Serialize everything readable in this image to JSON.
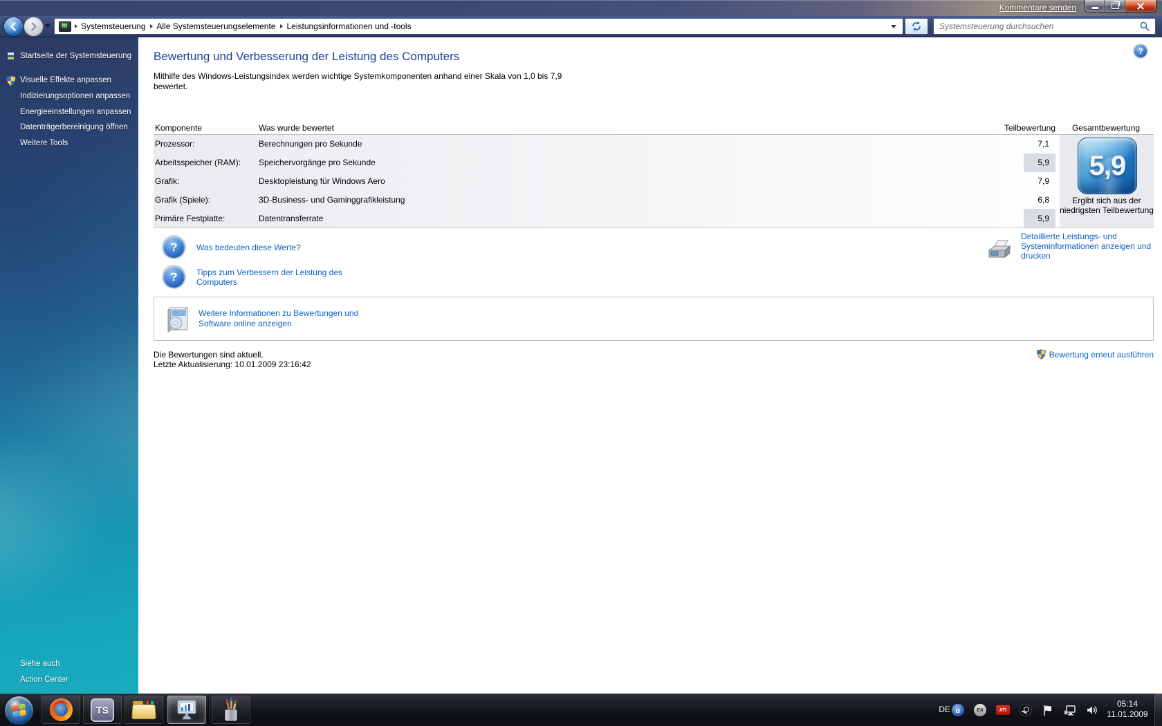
{
  "window": {
    "feedback_link": "Kommentare senden",
    "breadcrumbs": [
      "Systemsteuerung",
      "Alle Systemsteuerungselemente",
      "Leistungsinformationen und -tools"
    ],
    "search_placeholder": "Systemsteuerung durchsuchen"
  },
  "sidebar": {
    "items": [
      {
        "label": "Startseite der Systemsteuerung"
      },
      {
        "label": "Visuelle Effekte anpassen"
      },
      {
        "label": "Indizierungsoptionen anpassen"
      },
      {
        "label": "Energieeinstellungen anpassen"
      },
      {
        "label": "Datenträgerbereinigung öffnen"
      },
      {
        "label": "Weitere Tools"
      }
    ],
    "see_also_header": "Siehe auch",
    "see_also_link": "Action Center"
  },
  "main": {
    "title": "Bewertung und Verbesserung der Leistung des Computers",
    "intro": "Mithilfe des Windows-Leistungsindex werden wichtige Systemkomponenten anhand einer Skala von 1,0 bis 7,9 bewertet.",
    "table": {
      "headers": {
        "component": "Komponente",
        "rated": "Was wurde bewertet",
        "subscore": "Teilbewertung",
        "base_score": "Gesamtbewertung"
      },
      "rows": [
        {
          "component": "Prozessor:",
          "rated": "Berechnungen pro Sekunde",
          "subscore": "7,1"
        },
        {
          "component": "Arbeitsspeicher (RAM):",
          "rated": "Speichervorgänge pro Sekunde",
          "subscore": "5,9"
        },
        {
          "component": "Grafik:",
          "rated": "Desktopleistung für Windows Aero",
          "subscore": "7,9"
        },
        {
          "component": "Grafik (Spiele):",
          "rated": "3D-Business- und Gaminggrafikleistung",
          "subscore": "6,8"
        },
        {
          "component": "Primäre Festplatte:",
          "rated": "Datentransferrate",
          "subscore": "5,9"
        }
      ],
      "base_score": "5,9",
      "base_score_caption": "Ergibt sich aus der niedrigsten Teilbewertung"
    },
    "links": {
      "what_values_mean": "Was bedeuten diese Werte?",
      "tips": "Tipps zum Verbessern der Leistung des Computers",
      "detailed_info": "Detaillierte Leistungs- und Systeminformationen anzeigen und drucken",
      "online_info": "Weitere Informationen zu Bewertungen und Software online anzeigen",
      "rerun": "Bewertung erneut ausführen"
    },
    "status": {
      "line1": "Die Bewertungen sind aktuell.",
      "line2": "Letzte Aktualisierung: 10.01.2009 23:16:42"
    }
  },
  "taskbar": {
    "teamspeak_label": "TS",
    "tray": {
      "language": "DE",
      "avira_label": "a",
      "ea_label": "EA",
      "ati_label": "ATI",
      "time": "05:14",
      "date": "11.01.2009"
    }
  },
  "colors": {
    "link_blue": "#0b61c4",
    "heading_blue": "#1c3e94",
    "badge_blue": "#2478c5",
    "sidebar_teal": "#16a5bb",
    "lowest_subscore_highlight": "#d9dde2"
  }
}
